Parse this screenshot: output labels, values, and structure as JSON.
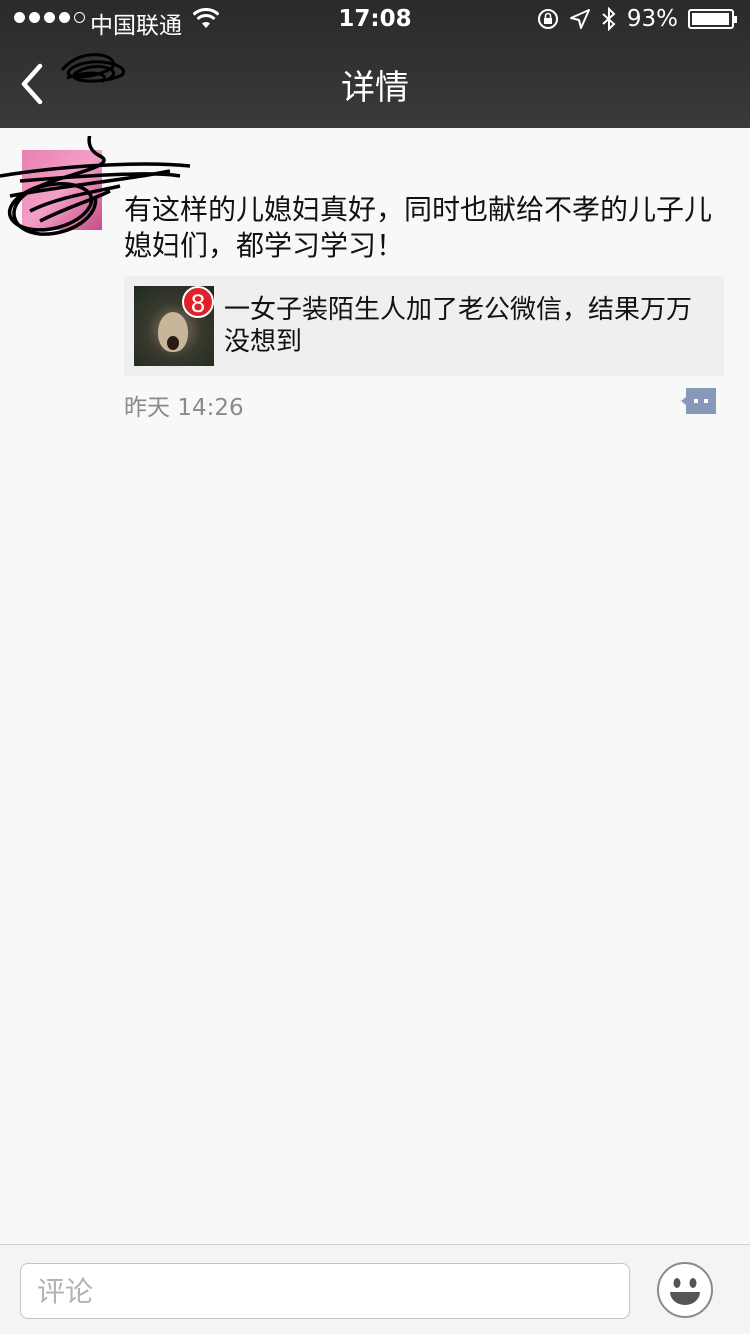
{
  "status_bar": {
    "carrier": "中国联通",
    "time": "17:08",
    "battery_percent": "93%",
    "battery_level": 0.93,
    "signal_bars_filled": 4,
    "signal_bars_total": 5
  },
  "nav": {
    "title": "详情",
    "back_icon": "chevron-left-icon"
  },
  "post": {
    "text": "有这样的儿媳妇真好，同时也献给不孝的儿子儿媳妇们，都学习学习！",
    "link": {
      "badge": "8",
      "title": "一女子装陌生人加了老公微信，结果万万没想到"
    },
    "timestamp": "昨天 14:26",
    "comment_icon": "comment-dots-icon"
  },
  "comment_bar": {
    "placeholder": "评论",
    "emoji_icon": "smiley-face-icon"
  },
  "colors": {
    "header_bg": "#333335",
    "page_bg": "#f8f8f8",
    "link_card_bg": "#efefef",
    "badge_red": "#e0202a",
    "comment_icon_blue": "#8898b8"
  }
}
